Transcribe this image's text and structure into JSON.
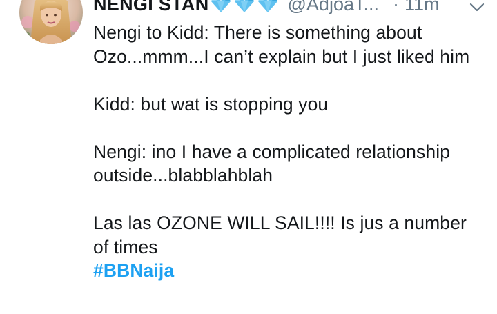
{
  "tweet": {
    "display_name": "NENGI STAN",
    "name_emoji_icons": [
      "gem-icon",
      "gem-icon",
      "gem-icon"
    ],
    "handle": "@AdjoaT...",
    "separator": "·",
    "time": "11m",
    "menu_icon": "chevron-down-icon",
    "text_lines": {
      "p1": "Nengi to Kidd: There is something about Ozo...mmm...I can’t explain but I just liked him",
      "p2": "Kidd: but wat is stopping you",
      "p3": "Nengi: ino I have a complicated relationship outside...blabblahblah",
      "p4": "Las las OZONE WILL SAIL!!!! Is jus a number of times"
    },
    "hashtag": "#BBNaija"
  },
  "colors": {
    "text": "#14171a",
    "secondary": "#657786",
    "link": "#1da1f2",
    "gem": "#5fc1f0"
  }
}
